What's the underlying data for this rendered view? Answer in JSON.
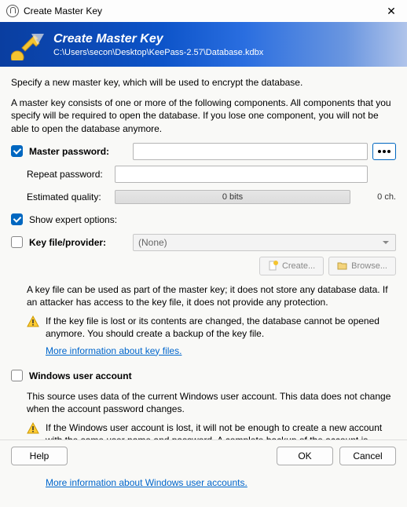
{
  "window": {
    "title": "Create Master Key"
  },
  "banner": {
    "title": "Create Master Key",
    "subtitle": "C:\\Users\\secon\\Desktop\\KeePass-2.57\\Database.kdbx"
  },
  "intro": {
    "p1": "Specify a new master key, which will be used to encrypt the database.",
    "p2": "A master key consists of one or more of the following components. All components that you specify will be required to open the database. If you lose one component, you will not be able to open the database anymore."
  },
  "masterpw": {
    "label": "Master password:",
    "repeat_label": "Repeat password:",
    "quality_label": "Estimated quality:",
    "quality_value": "0 bits",
    "char_count": "0 ch."
  },
  "expert": {
    "label": "Show expert options:"
  },
  "keyfile": {
    "label": "Key file/provider:",
    "selected": "(None)",
    "create": "Create...",
    "browse": "Browse...",
    "info": "A key file can be used as part of the master key; it does not store any database data. If an attacker has access to the key file, it does not provide any protection.",
    "warn": "If the key file is lost or its contents are changed, the database cannot be opened anymore. You should create a backup of the key file.",
    "link": "More information about key files."
  },
  "wua": {
    "label": "Windows user account",
    "info": "This source uses data of the current Windows user account. This data does not change when the account password changes.",
    "warn": "If the Windows user account is lost, it will not be enough to create a new account with the same user name and password. A complete backup of the account is required. Creating and restoring such a backup is a very complicated task. If you don't know how to do this, don't enable this option.",
    "link": "More information about Windows user accounts."
  },
  "footer": {
    "help": "Help",
    "ok": "OK",
    "cancel": "Cancel"
  }
}
